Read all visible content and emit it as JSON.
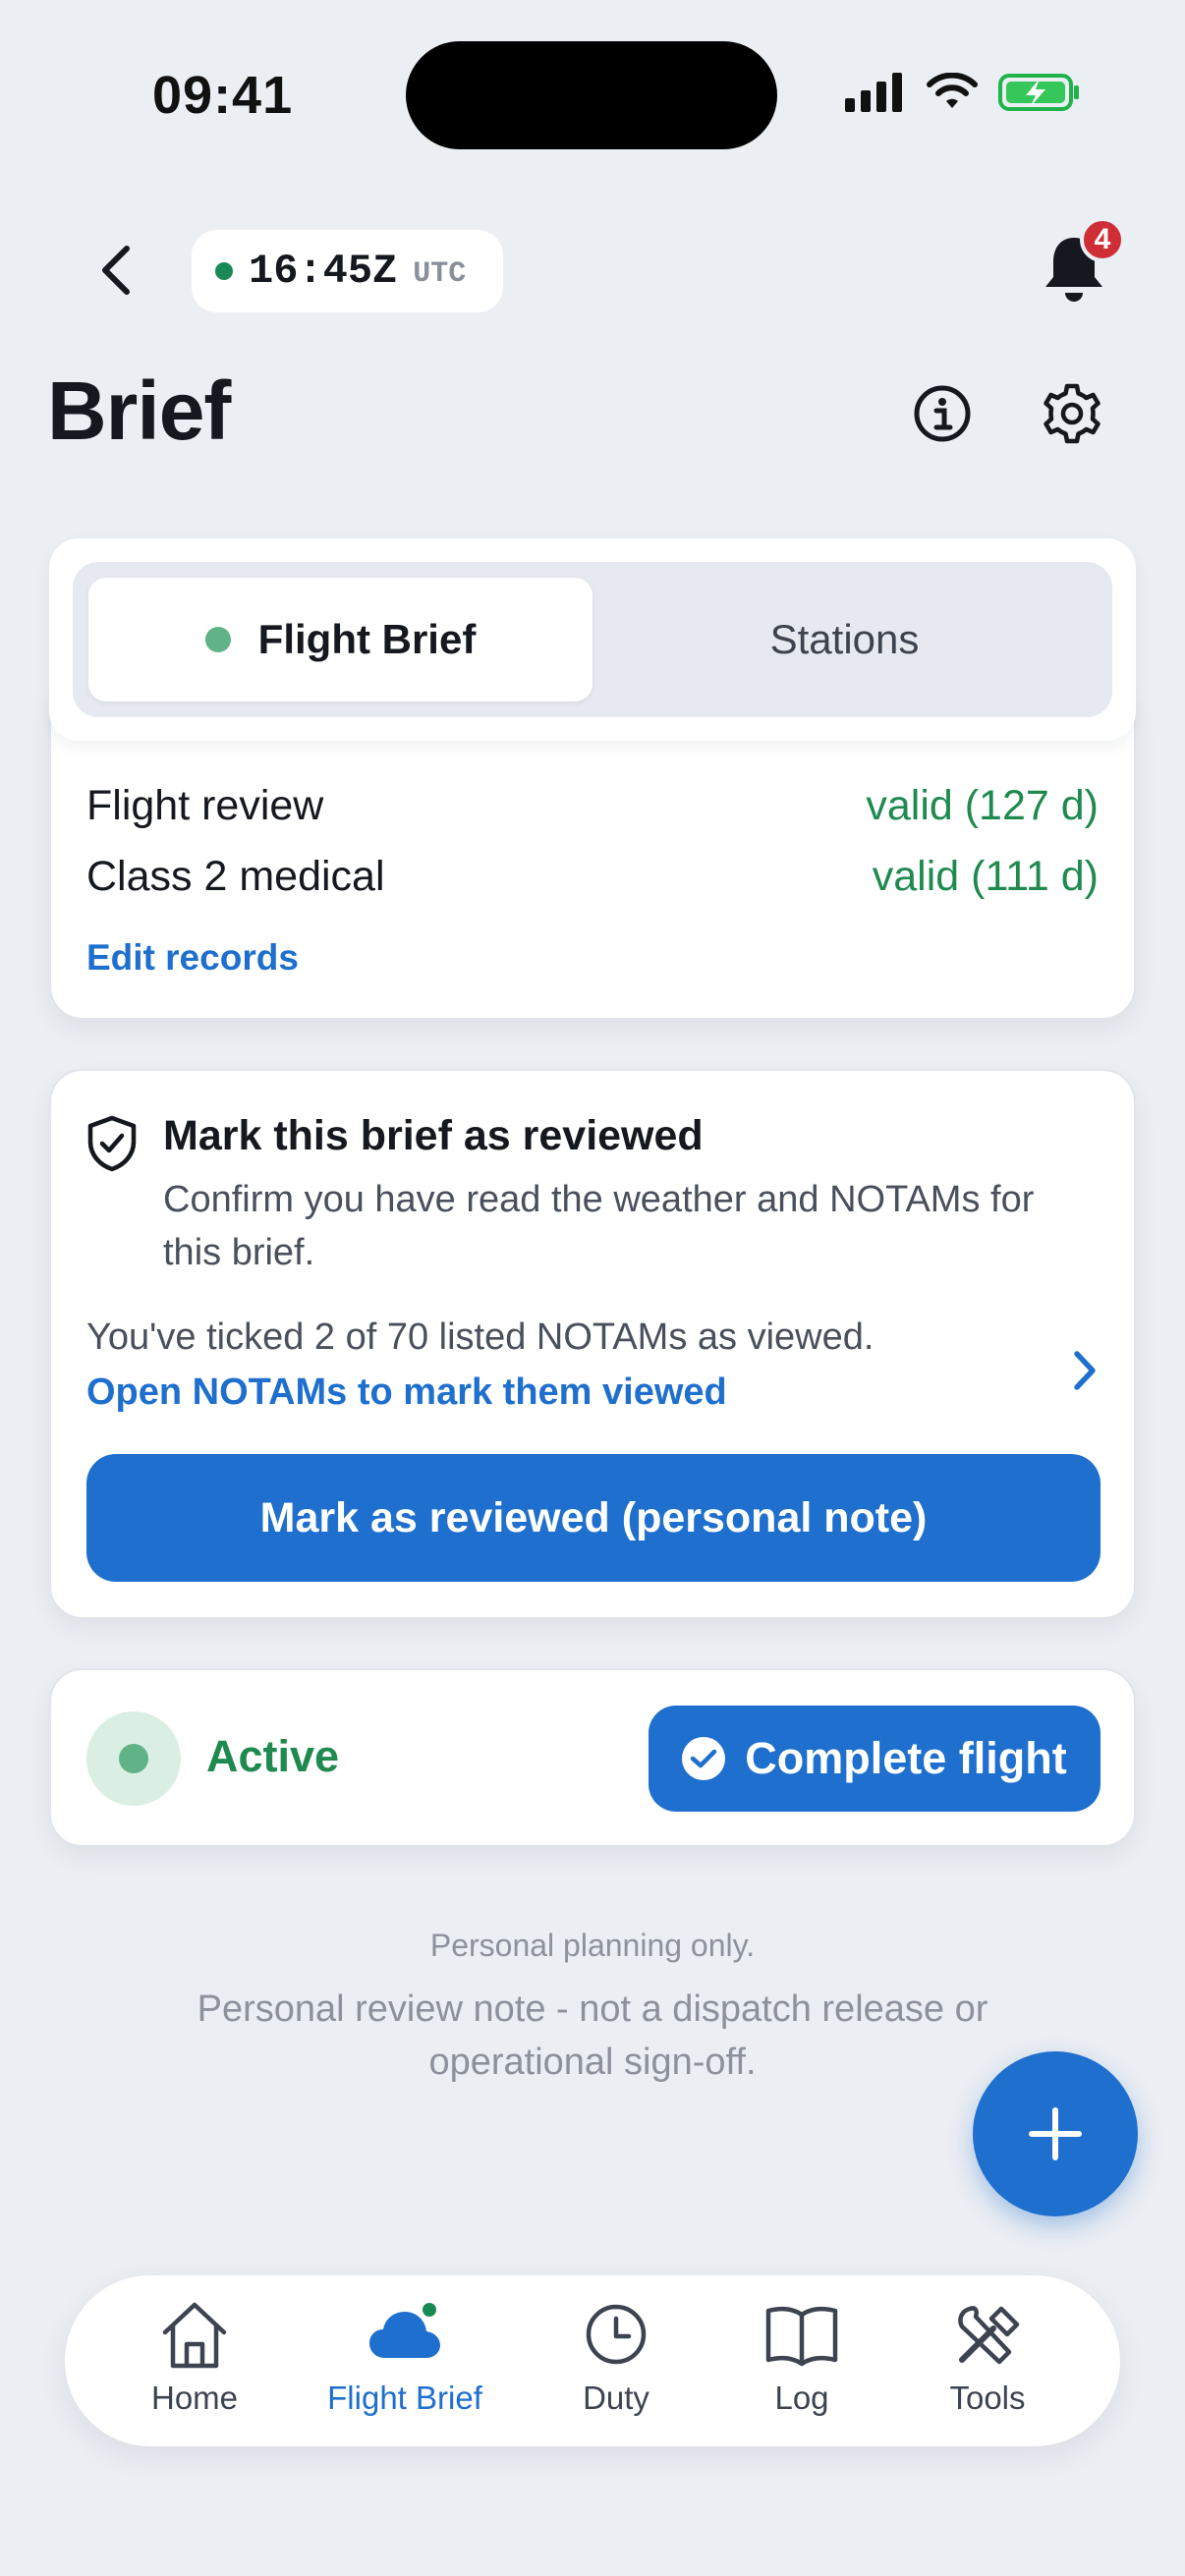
{
  "status_bar": {
    "time": "09:41"
  },
  "header": {
    "utc_time": "16:45Z",
    "utc_label": "UTC",
    "notification_count": "4",
    "title": "Brief"
  },
  "segments": {
    "tabs": [
      {
        "label": "Flight Brief",
        "active": true
      },
      {
        "label": "Stations",
        "active": false
      }
    ]
  },
  "records": {
    "items": [
      {
        "label": "Flight review",
        "value": "valid (127 d)"
      },
      {
        "label": "Class 2 medical",
        "value": "valid (111 d)"
      }
    ],
    "edit_link": "Edit records"
  },
  "review": {
    "title": "Mark this brief as reviewed",
    "description": "Confirm you have read the weather and NOTAMs for this brief.",
    "notam_count_text": "You've ticked 2 of 70 listed NOTAMs as viewed.",
    "open_link": "Open NOTAMs to mark them viewed",
    "button_label": "Mark as reviewed (personal note)"
  },
  "flight_status": {
    "label": "Active",
    "complete_label": "Complete flight"
  },
  "footer": {
    "small_text": "Personal planning only.",
    "note": "Personal review note - not a dispatch release or operational sign-off."
  },
  "nav": {
    "items": [
      {
        "label": "Home",
        "icon": "home-icon"
      },
      {
        "label": "Flight Brief",
        "icon": "cloud-icon",
        "active": true
      },
      {
        "label": "Duty",
        "icon": "clock-icon"
      },
      {
        "label": "Log",
        "icon": "book-icon"
      },
      {
        "label": "Tools",
        "icon": "tools-icon"
      }
    ]
  },
  "colors": {
    "accent": "#1f6fce",
    "success": "#1f8a4f",
    "badge": "#cf2e36",
    "background": "#ebeef3"
  }
}
